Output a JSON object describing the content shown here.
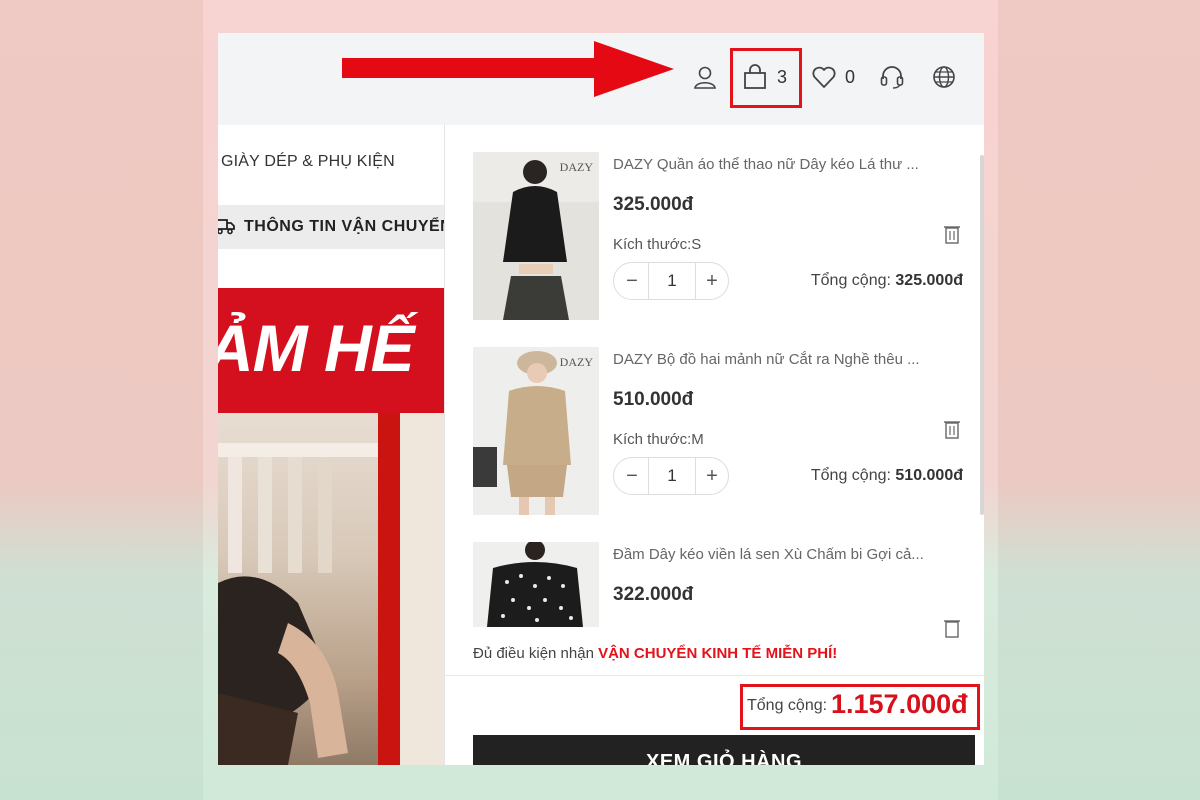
{
  "header": {
    "cart_count": "3",
    "wishlist_count": "0",
    "icons": [
      "user-icon",
      "shopping-bag-icon",
      "heart-icon",
      "headset-icon",
      "globe-icon"
    ],
    "highlight_color": "#e3131b"
  },
  "left": {
    "category": "GIÀY DÉP & PHỤ KIỆN",
    "shipping_info": "THÔNG TIN VẬN CHUYỂN",
    "banner_text": "ẢM HẾ"
  },
  "cart": {
    "items": [
      {
        "brand": "DAZY",
        "name": "DAZY Quần áo thể thao nữ Dây kéo Lá thư ...",
        "price": "325.000đ",
        "size": "Kích thước:S",
        "quantity": "1",
        "total_label": "Tổng cộng:",
        "total": "325.000đ"
      },
      {
        "brand": "DAZY",
        "name": "DAZY Bộ đồ hai mảnh nữ Cắt ra Nghề thêu ...",
        "price": "510.000đ",
        "size": "Kích thước:M",
        "quantity": "1",
        "total_label": "Tổng cộng:",
        "total": "510.000đ"
      },
      {
        "brand": "",
        "name": "Đầm Dây kéo viền lá sen Xù Chấm bi Gợi cả...",
        "price": "322.000đ"
      }
    ],
    "minus": "−",
    "plus": "+",
    "free_shipping_prefix": "Đủ điều kiện nhận ",
    "free_shipping_highlight": "VẬN CHUYỂN KINH TẾ MIỄN PHÍ!",
    "grand_total_label": "Tổng cộng:",
    "grand_total": "1.157.000đ",
    "view_cart": "XEM GIỎ HÀNG"
  }
}
